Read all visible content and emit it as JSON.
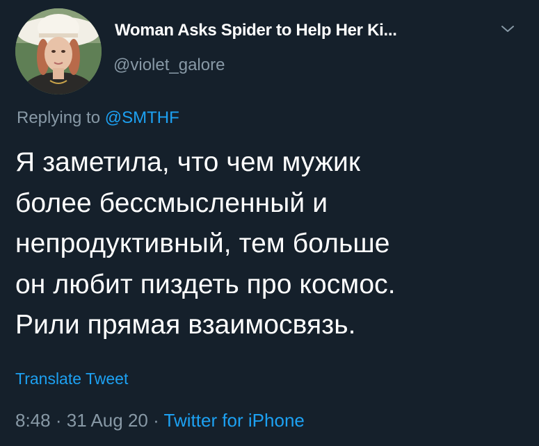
{
  "tweet": {
    "author": {
      "display_name": "Woman Asks Spider to Help Her Ki...",
      "handle": "@violet_galore",
      "avatar_icon": "profile-photo-avatar"
    },
    "menu_icon": "chevron-down-icon",
    "reply": {
      "prefix": "Replying to",
      "mention": "@SMTHF"
    },
    "text": "Я заметила, что чем мужик\nболее бессмысленный и\nнепродуктивный, тем больше\nон любит пиздеть про космос.\nРили прямая взаимосвязь.",
    "translate_label": "Translate Tweet",
    "meta": {
      "time": "8:48",
      "separator": "·",
      "date": "31 Aug 20",
      "source": "Twitter for iPhone"
    }
  },
  "colors": {
    "background": "#15202b",
    "text_primary": "#ffffff",
    "text_secondary": "#8899a6",
    "accent": "#1da1f2"
  }
}
